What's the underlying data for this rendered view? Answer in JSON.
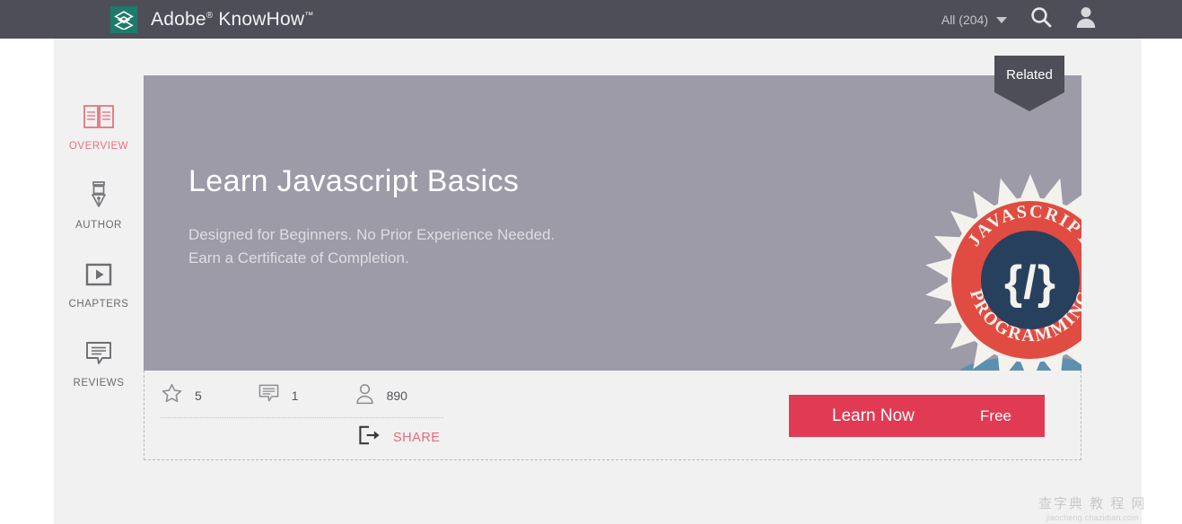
{
  "topbar": {
    "logo_icon": "adobe-layers-logo",
    "brand_name": "Adobe",
    "brand_sup": "®",
    "brand_product": " KnowHow",
    "brand_tm": "™",
    "filter_label": "All (204)",
    "caret_icon": "chevron-down-icon",
    "search_icon": "search-icon",
    "account_icon": "user-avatar-icon",
    "bg_color": "#4d4e58"
  },
  "sidebar": {
    "items": [
      {
        "label": "OVERVIEW",
        "icon": "open-book-icon",
        "active": true
      },
      {
        "label": "AUTHOR",
        "icon": "pen-nib-icon",
        "active": false
      },
      {
        "label": "CHAPTERS",
        "icon": "video-play-icon",
        "active": false
      },
      {
        "label": "REVIEWS",
        "icon": "speech-bubble-icon",
        "active": false
      }
    ],
    "active_color": "#e8727e",
    "inactive_color": "#6c6c70"
  },
  "hero": {
    "title": "Learn Javascript Basics",
    "subtitle_line1": "Designed for Beginners. No Prior Experience Needed.",
    "subtitle_line2": "Earn a Certificate of Completion.",
    "bg_color": "#9d9ba8",
    "badge": {
      "icon": "javascript-programming-badge",
      "top_text": "JAVASCRIPT",
      "bottom_text": "PROGRAMMING",
      "center_symbol": "{/}",
      "ring_color": "#e04c42",
      "core_color": "#27405e",
      "burst_color": "#f4f2ed",
      "shadow_color": "#5d8fb0"
    }
  },
  "related_tab": {
    "label": "Related",
    "bg_color": "#4d4e58"
  },
  "stats": [
    {
      "icon": "star-icon",
      "value": "5",
      "name": "rating"
    },
    {
      "icon": "comment-icon",
      "value": "1",
      "name": "comments"
    },
    {
      "icon": "user-icon",
      "value": "890",
      "name": "learners"
    }
  ],
  "share": {
    "icon": "share-export-icon",
    "label": "SHARE",
    "color": "#e8687a"
  },
  "cta": {
    "label": "Learn Now",
    "price": "Free",
    "bg_color": "#e13a54"
  },
  "watermark": {
    "text_cn": "查字典 教 程 网",
    "url": "jiaocheng.chazidian.com"
  }
}
